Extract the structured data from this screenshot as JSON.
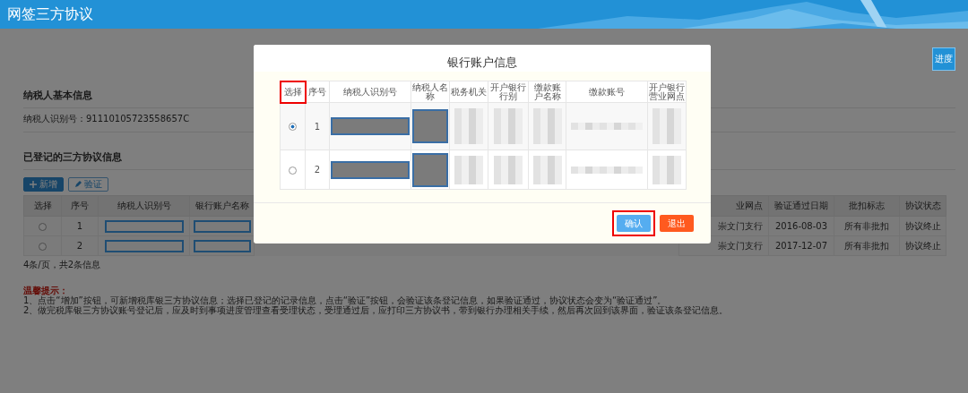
{
  "window": {
    "title": "网签三方协议"
  },
  "progress_button": "进度",
  "taxpayer_section": {
    "title": "纳税人基本信息",
    "id_line": "纳税人识别号：91110105723558657C"
  },
  "agreements_section": {
    "title": "已登记的三方协议信息",
    "buttons": [
      {
        "label": "新增",
        "kind": "add"
      },
      {
        "label": "验证",
        "kind": "verify"
      }
    ],
    "table": {
      "left_columns": [
        "选择",
        "序号",
        "纳税人识别号",
        "银行账户名称"
      ],
      "right_columns": [
        "业网点",
        "验证通过日期",
        "批扣标志",
        "协议状态"
      ],
      "rows": [
        {
          "selected": false,
          "no": "1",
          "branch": "崇文门支行",
          "verified_date": "2016-08-03",
          "deduction_flag": "所有非批扣",
          "status": "协议终止"
        },
        {
          "selected": false,
          "no": "2",
          "branch": "崇文门支行",
          "verified_date": "2017-12-07",
          "deduction_flag": "所有非批扣",
          "status": "协议终止"
        }
      ]
    },
    "pagination": "4条/页，共2条信息"
  },
  "tips": {
    "title": "温馨提示：",
    "lines": [
      "1、点击“增加”按钮，可新增税库银三方协议信息；选择已登记的记录信息，点击“验证”按钮，会验证该条登记信息，如果验证通过，协议状态会变为“验证通过”。",
      "2、做完税库银三方协议账号登记后，应及时到事项进度管理查看受理状态，受理通过后，应打印三方协议书，带到银行办理相关手续，然后再次回到该界面，验证该条登记信息。"
    ]
  },
  "modal": {
    "title": "银行账户信息",
    "columns": [
      {
        "label": "选择",
        "kind": "radio",
        "highlighted": true
      },
      {
        "label": "序号",
        "kind": "number",
        "highlighted": false
      },
      {
        "label": "纳税人识别号",
        "kind": "redacted-wide",
        "highlighted": false
      },
      {
        "label": "纳税人名称",
        "kind": "redacted-tall",
        "highlighted": false
      },
      {
        "label": "税务机关",
        "kind": "pixelated",
        "highlighted": false
      },
      {
        "label": "开户银行行别",
        "kind": "pixelated",
        "highlighted": false
      },
      {
        "label": "缴款账户名称",
        "kind": "pixelated",
        "highlighted": false
      },
      {
        "label": "缴款账号",
        "kind": "pixelated-line",
        "highlighted": false
      },
      {
        "label": "开户银行营业网点",
        "kind": "pixelated",
        "highlighted": false
      }
    ],
    "rows": [
      {
        "selected": true,
        "no": "1"
      },
      {
        "selected": false,
        "no": "2"
      }
    ],
    "buttons": [
      {
        "label": "确认",
        "kind": "confirm",
        "highlighted": true
      },
      {
        "label": "退出",
        "kind": "exit",
        "highlighted": false
      }
    ]
  }
}
